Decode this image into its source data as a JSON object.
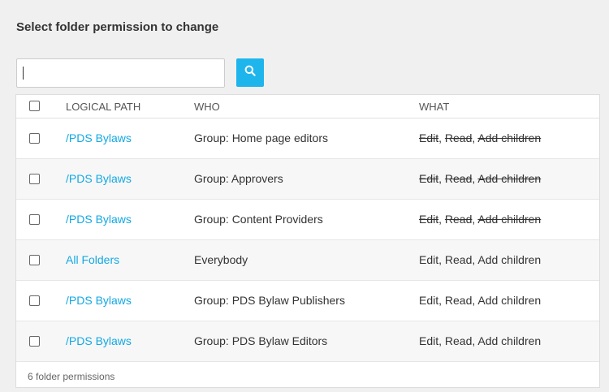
{
  "page_title": "Select folder permission to change",
  "search": {
    "value": "",
    "placeholder": ""
  },
  "table": {
    "headers": {
      "path": "LOGICAL PATH",
      "who": "WHO",
      "what": "WHAT"
    },
    "rows": [
      {
        "path": "/PDS Bylaws",
        "who": "Group: Home page editors",
        "what": [
          {
            "text": "Edit",
            "strike": true
          },
          {
            "text": ", ",
            "strike": false
          },
          {
            "text": "Read",
            "strike": true
          },
          {
            "text": ", ",
            "strike": false
          },
          {
            "text": "Add children",
            "strike": true
          }
        ]
      },
      {
        "path": "/PDS Bylaws",
        "who": "Group: Approvers",
        "what": [
          {
            "text": "Edit",
            "strike": true
          },
          {
            "text": ", ",
            "strike": false
          },
          {
            "text": "Read",
            "strike": true
          },
          {
            "text": ", ",
            "strike": false
          },
          {
            "text": "Add children",
            "strike": true
          }
        ]
      },
      {
        "path": "/PDS Bylaws",
        "who": "Group: Content Providers",
        "what": [
          {
            "text": "Edit",
            "strike": true
          },
          {
            "text": ", ",
            "strike": false
          },
          {
            "text": "Read",
            "strike": true
          },
          {
            "text": ", ",
            "strike": false
          },
          {
            "text": "Add children",
            "strike": true
          }
        ]
      },
      {
        "path": "All Folders",
        "who": "Everybody",
        "what": [
          {
            "text": "Edit, Read, Add children",
            "strike": false
          }
        ]
      },
      {
        "path": "/PDS Bylaws",
        "who": "Group: PDS Bylaw Publishers",
        "what": [
          {
            "text": "Edit, Read, Add children",
            "strike": false
          }
        ]
      },
      {
        "path": "/PDS Bylaws",
        "who": "Group: PDS Bylaw Editors",
        "what": [
          {
            "text": "Edit, Read, Add children",
            "strike": false
          }
        ]
      }
    ],
    "footer": "6 folder permissions"
  },
  "colors": {
    "accent": "#1eb5ed",
    "link": "#12a9e3"
  },
  "icons": {
    "search_button": "search-icon"
  }
}
